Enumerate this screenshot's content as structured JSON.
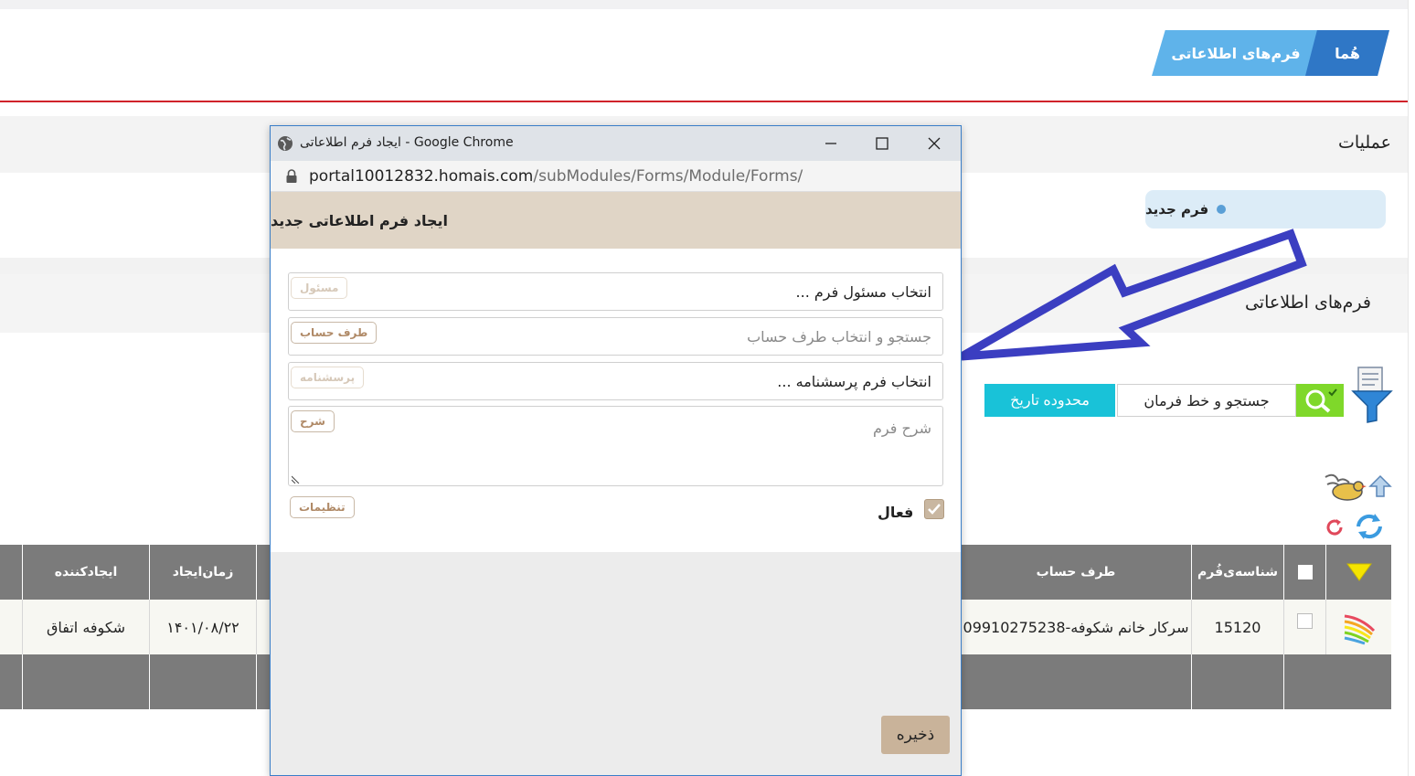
{
  "breadcrumb": {
    "home": "هُما",
    "forms": "فرم‌های اطلاعاتی"
  },
  "operations": {
    "title": "عملیات",
    "new_form": "فرم جدید"
  },
  "forms_section": {
    "title": "فرم‌های اطلاعاتی",
    "search_placeholder": "جستجو و خط فرمان",
    "date_range_button": "محدوده تاریخ"
  },
  "table": {
    "headers": {
      "form_id": "شناسه‌ی‌فُرم",
      "account_party": "طرف حساب",
      "created_time": "زمان‌ایجاد",
      "creator": "ایجادکننده"
    },
    "rows": [
      {
        "form_id": "15120",
        "account_party": "سرکار خانم شکوفه-09910275238",
        "created_time": "۱۴۰۱/۰۸/۲۲",
        "creator": "شکوفه اتفاق"
      }
    ]
  },
  "popup": {
    "window_title": "ایجاد فرم اطلاعاتی",
    "window_title_suffix": " - Google Chrome",
    "url_domain": "portal10012832.homais.com",
    "url_path": "/subModules/Forms/Module/Forms/",
    "header": "ایجاد فرم اطلاعاتی جدید",
    "fields": [
      {
        "value": "انتخاب مسئول فرم ...",
        "tag": "مسئول"
      },
      {
        "placeholder": "جستجو و انتخاب طرف حساب",
        "tag": "طرف حساب"
      },
      {
        "value": "انتخاب فرم پرسشنامه ...",
        "tag": "پرسشنامه"
      },
      {
        "placeholder": "شرح فرم",
        "tag": "شرح"
      }
    ],
    "active_label": "فعال",
    "active_checked": true,
    "settings_button": "تنظیمات",
    "save_button": "ذخیره"
  },
  "colors": {
    "accent_blue": "#2f77c6",
    "light_blue": "#5fb3ea",
    "red_line": "#d0222a",
    "date_button": "#19c2d8",
    "search_button": "#7fd82a",
    "arrow": "#3b3ec1",
    "form_header_bg": "#e0d5c6",
    "save_button_bg": "#c9b39a",
    "table_header_bg": "#7b7b7b"
  }
}
